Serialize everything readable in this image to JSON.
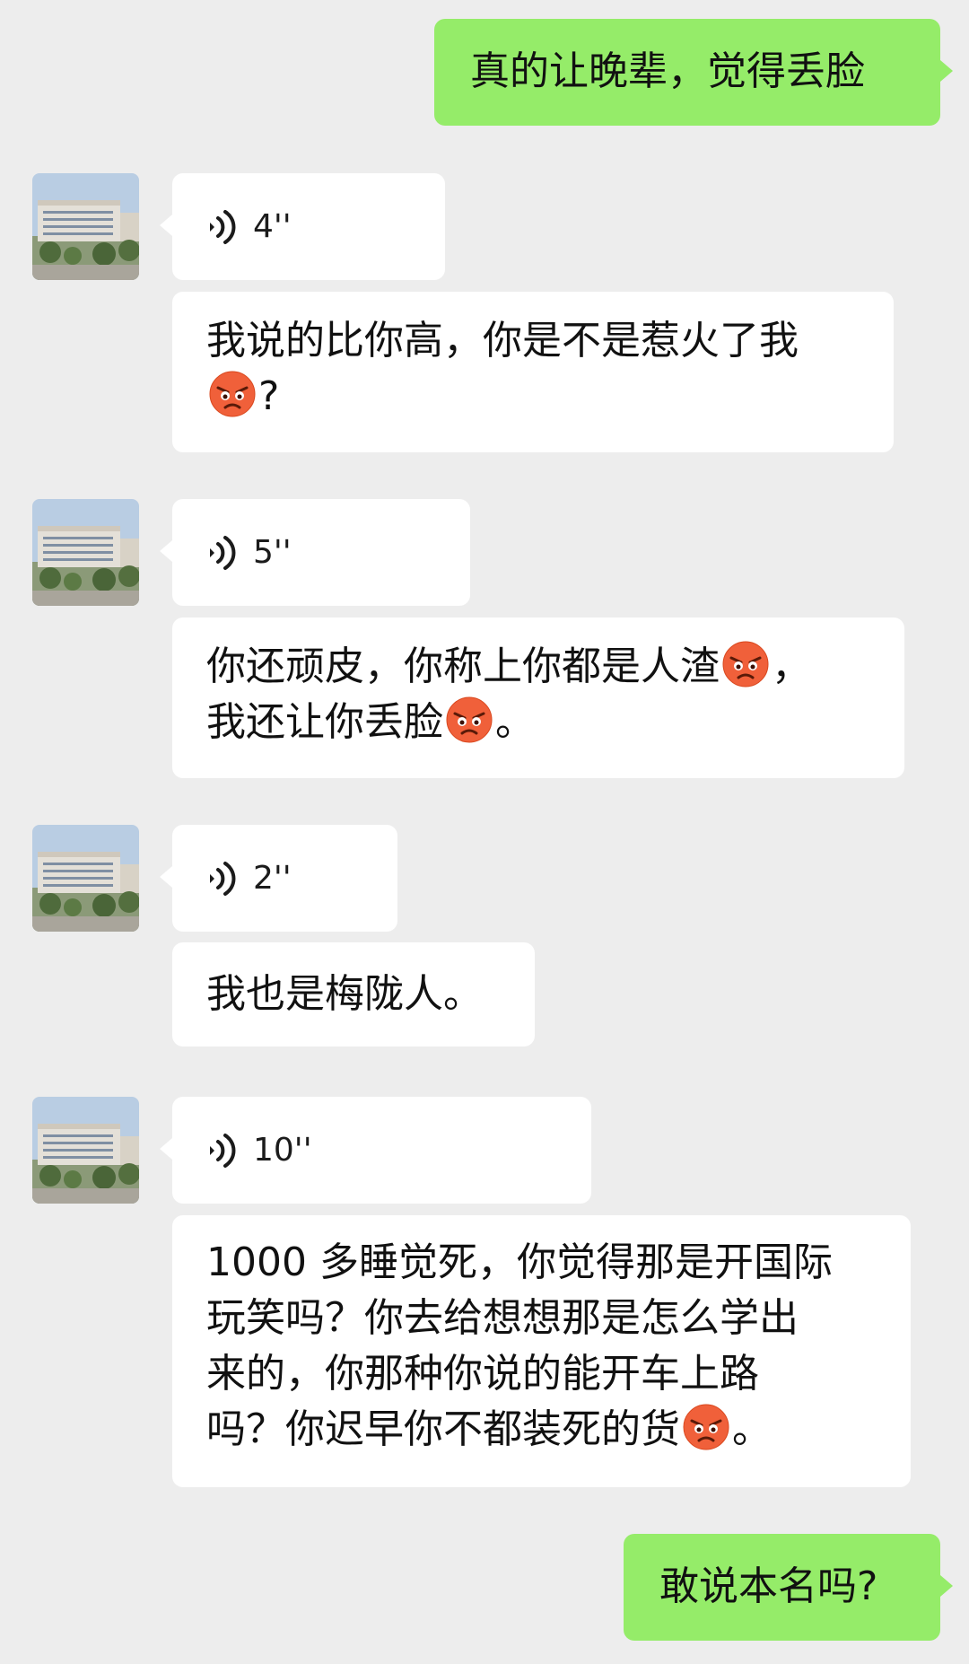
{
  "messages": {
    "m1": "真的让晚辈，觉得丢脸",
    "v1": "4''",
    "m2a": "我说的比你高，你是不是惹火了我",
    "m2b": "?",
    "v2": "5''",
    "m3a": "你还顽皮，你称上你都是人渣",
    "m3b": "，",
    "m3c": "我还让你丢脸",
    "m3d": "。",
    "v3": "2''",
    "m4": "我也是梅陇人。",
    "v4": "10''",
    "m5a": "1000 多睡觉死，你觉得那是开国际",
    "m5b": "玩笑吗？你去给想想那是怎么学出",
    "m5c": "来的，你那种你说的能开车上路",
    "m5d": "吗？你迟早你不都装死的货",
    "m5e": "。",
    "m6": "敢说本名吗?"
  },
  "icons": {
    "voice": "voice-wave-icon",
    "emoji": "angry-face-emoji"
  },
  "colors": {
    "background": "#ededed",
    "incoming_bubble": "#ffffff",
    "outgoing_bubble": "#95ec69"
  }
}
